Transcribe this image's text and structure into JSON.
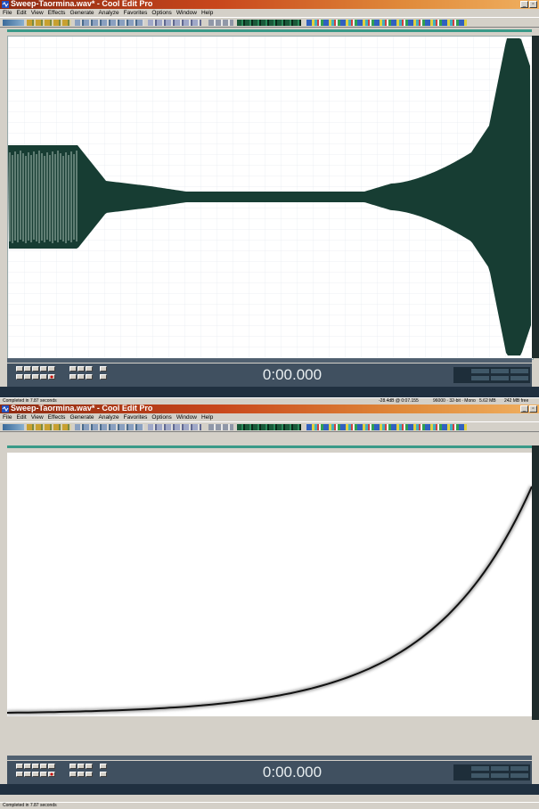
{
  "windows": [
    {
      "title": "Sweep-Taormina.wav* - Cool Edit Pro",
      "menu": [
        "File",
        "Edit",
        "View",
        "Effects",
        "Generate",
        "Analyze",
        "Favorites",
        "Options",
        "Window",
        "Help"
      ],
      "view": "waveform",
      "waveform_color": "#173d33",
      "time": "0:00.000",
      "status": {
        "message": "Completed in 7.87 seconds",
        "level": "-28.4dB @ 0:07.155",
        "format": "96000 · 32-bit · Mono",
        "size": "5.62 MB",
        "free": "242 MB free"
      }
    },
    {
      "title": "Sweep-Taormina.wav* - Cool Edit Pro",
      "menu": [
        "File",
        "Edit",
        "View",
        "Effects",
        "Generate",
        "Analyze",
        "Favorites",
        "Options",
        "Window",
        "Help"
      ],
      "view": "spectral",
      "curve_color": "#111111",
      "time": "0:00.000",
      "status": {
        "message": "Completed in 7.87 seconds"
      }
    }
  ],
  "colors": {
    "title_bar": "#c8461c",
    "chrome": "#d4d0c8",
    "transport": "#405060",
    "accent_line": "#3a9a88"
  }
}
